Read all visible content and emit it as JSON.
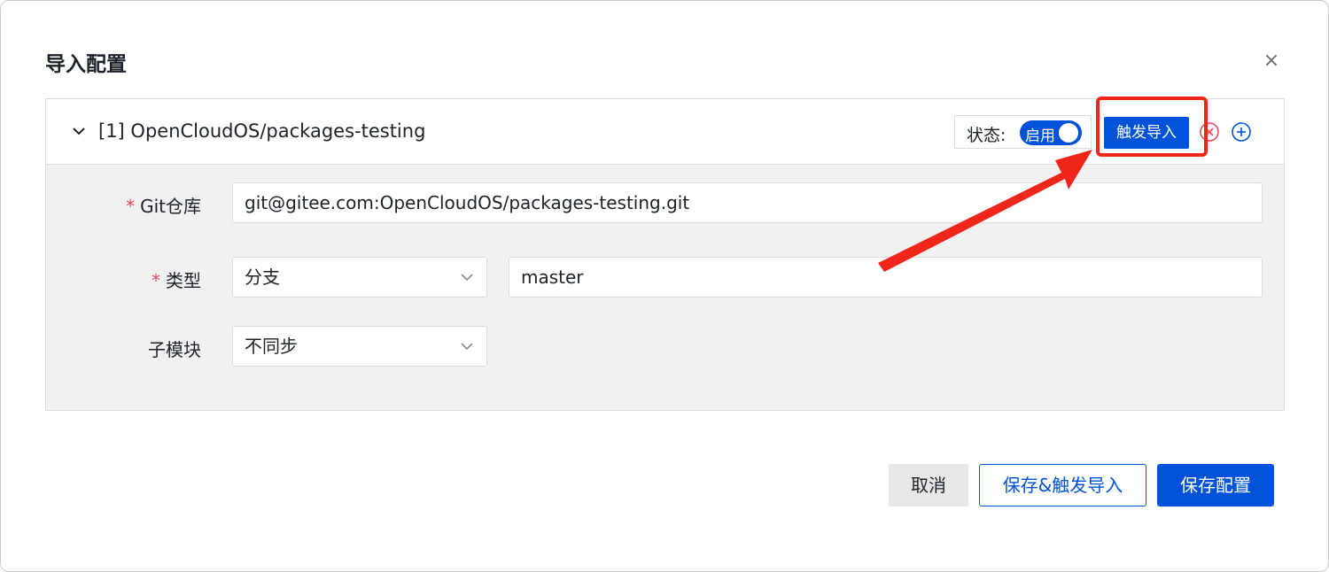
{
  "dialog": {
    "title": "导入配置",
    "close_label": "×"
  },
  "config": {
    "repo_title": "[1] OpenCloudOS/packages-testing",
    "status_label": "状态:",
    "toggle_text": "启用",
    "toggle_on": true,
    "trigger_label": "触发导入"
  },
  "form": {
    "git_label": "Git仓库",
    "git_value": "git@gitee.com:OpenCloudOS/packages-testing.git",
    "type_label": "类型",
    "type_select": "分支",
    "type_value": "master",
    "submodule_label": "子模块",
    "submodule_select": "不同步",
    "required_mark": "*"
  },
  "footer": {
    "cancel": "取消",
    "save_trigger": "保存&触发导入",
    "save": "保存配置"
  },
  "colors": {
    "primary": "#0052d9",
    "annotation": "#f0261a",
    "danger": "#e34d59"
  }
}
